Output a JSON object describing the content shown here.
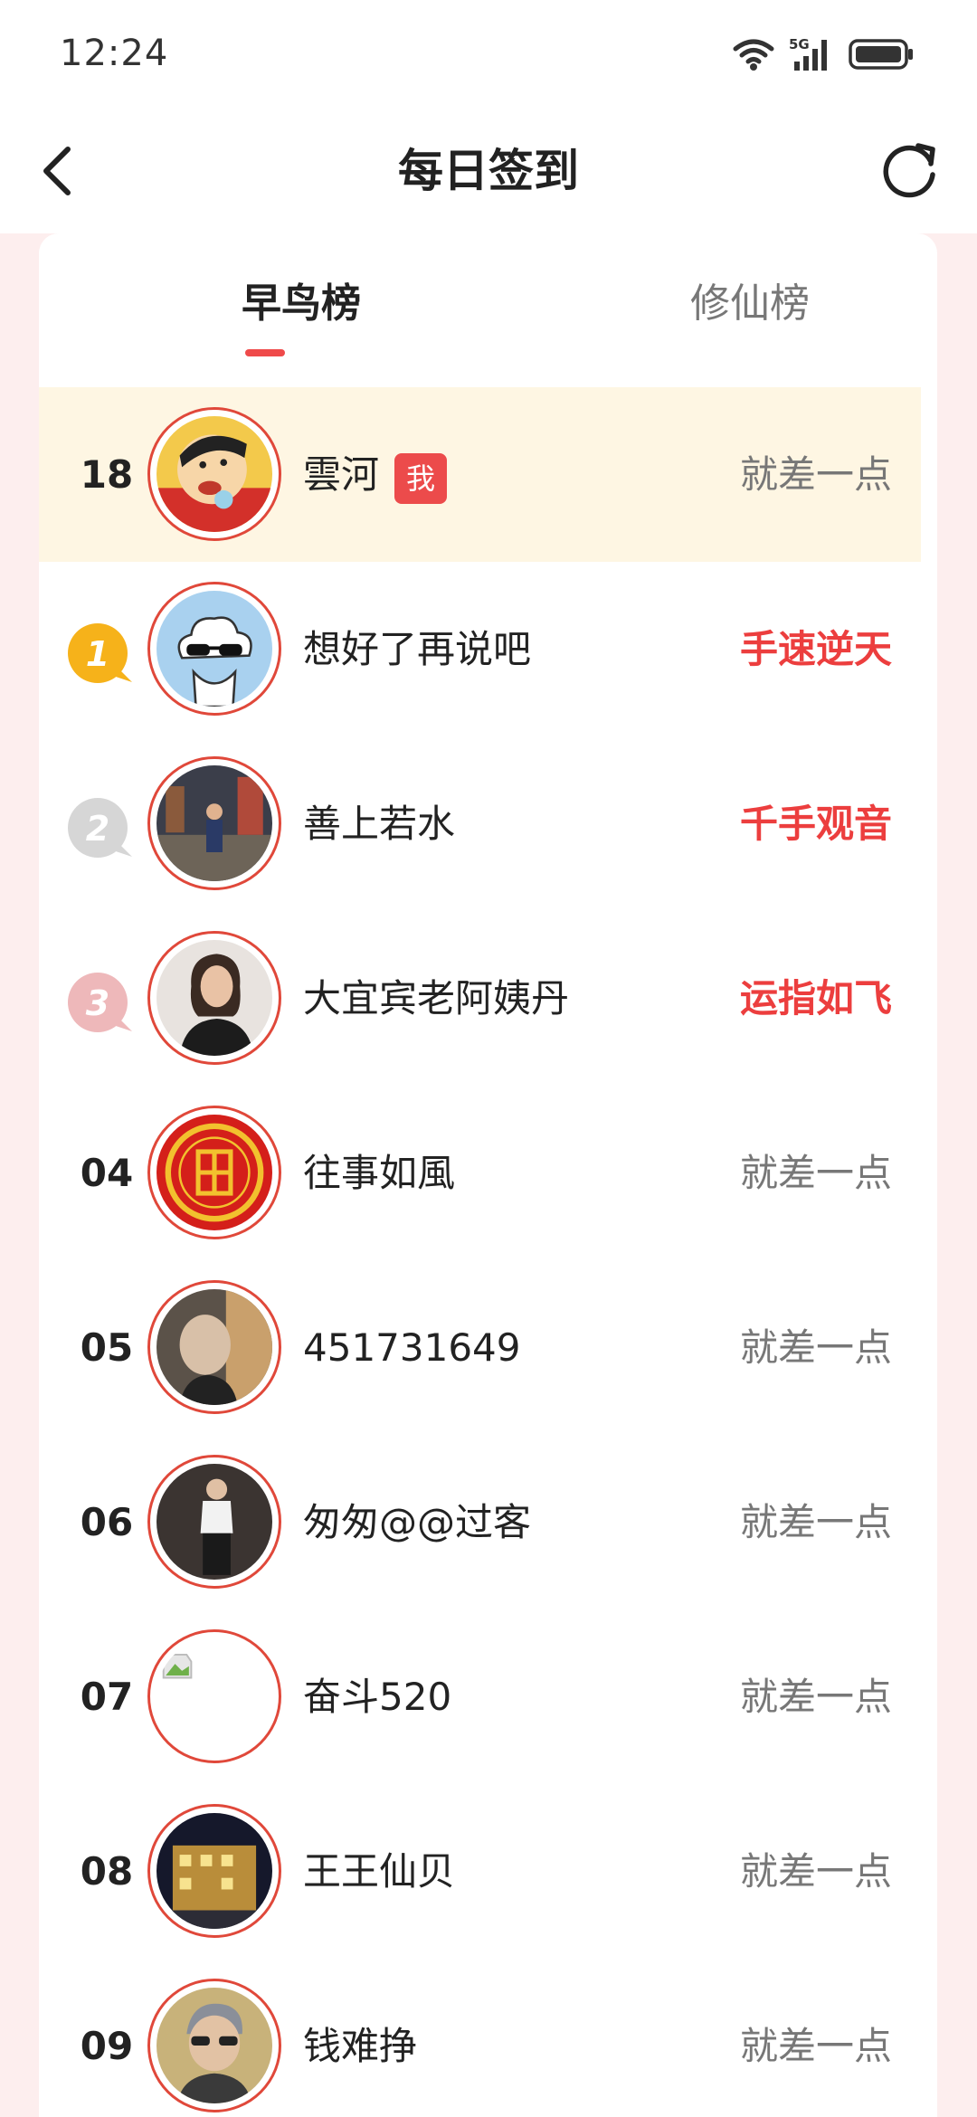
{
  "status_bar": {
    "time": "12:24",
    "network": "5G",
    "icons": [
      "wifi-icon",
      "signal-icon",
      "battery-icon"
    ]
  },
  "header": {
    "title": "每日签到",
    "back_icon": "back-arrow-icon",
    "refresh_icon": "refresh-icon"
  },
  "tabs": [
    {
      "label": "早鸟榜",
      "active": true
    },
    {
      "label": "修仙榜",
      "active": false
    }
  ],
  "colors": {
    "accent": "#ec4b4b",
    "me_row_bg": "#fef6e3",
    "page_bg": "#fdeeee",
    "gold": "#f6b21a",
    "silver": "#d6d6d6",
    "bronze": "#eeb8ba"
  },
  "me_badge": "我",
  "ranking": [
    {
      "rank": "18",
      "name": "雲河",
      "status": "就差一点",
      "is_me": true
    },
    {
      "rank": "1",
      "name": "想好了再说吧",
      "status": "手速逆天",
      "medal": "gold"
    },
    {
      "rank": "2",
      "name": "善上若水",
      "status": "千手观音",
      "medal": "silver"
    },
    {
      "rank": "3",
      "name": "大宜宾老阿姨丹",
      "status": "运指如飞",
      "medal": "bronze"
    },
    {
      "rank": "04",
      "name": "往事如風",
      "status": "就差一点"
    },
    {
      "rank": "05",
      "name": "451731649",
      "status": "就差一点"
    },
    {
      "rank": "06",
      "name": "匆匆@@过客",
      "status": "就差一点"
    },
    {
      "rank": "07",
      "name": "奋斗520",
      "status": "就差一点"
    },
    {
      "rank": "08",
      "name": "王王仙贝",
      "status": "就差一点"
    },
    {
      "rank": "09",
      "name": "钱难挣",
      "status": "就差一点"
    }
  ]
}
